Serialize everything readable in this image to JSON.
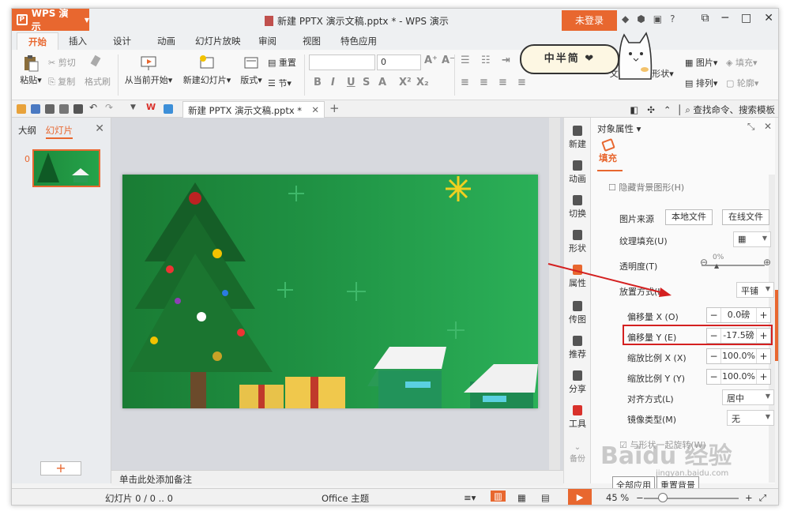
{
  "titlebar": {
    "app_name": "WPS 演示",
    "doc_title": "新建 PPTX 演示文稿.pptx * - WPS 演示",
    "login": "未登录"
  },
  "menu": [
    "开始",
    "插入",
    "设计",
    "动画",
    "幻灯片放映",
    "审阅",
    "视图",
    "特色应用"
  ],
  "ribbon": {
    "paste": "粘贴",
    "cut": "剪切",
    "copy": "复制",
    "format_painter": "格式刷",
    "from_current": "从当前开始",
    "new_slide": "新建幻灯片",
    "layout": "版式",
    "reset": "重置",
    "section": "节",
    "font_size": "0",
    "textbox": "文本框",
    "shape": "形状",
    "picture": "图片",
    "fill": "填充",
    "arrange": "排列",
    "outline": "轮廓"
  },
  "quickbar": {
    "doc_tab": "新建 PPTX 演示文稿.pptx *",
    "search": "查找命令、搜索模板"
  },
  "left_pane": {
    "tab_outline": "大纲",
    "tab_slides": "幻灯片",
    "slide_number": "0"
  },
  "notes_placeholder": "单击此处添加备注",
  "side_strip": [
    "新建",
    "动画",
    "切换",
    "形状",
    "属性",
    "传图",
    "推荐",
    "分享",
    "工具",
    "备份"
  ],
  "props": {
    "header": "对象属性",
    "fill_tab": "填充",
    "hidden_bg": "隐藏背景图形(H)",
    "picture_source": "图片来源",
    "local_file": "本地文件",
    "online_file": "在线文件",
    "texture_fill": "纹理填充(U)",
    "transparency": "透明度(T)",
    "transparency_value": "0%",
    "placement": "放置方式(I)",
    "placement_value": "平铺",
    "offset_x_label": "偏移量 X (O)",
    "offset_x": "0.0磅",
    "offset_y_label": "偏移量 Y (E)",
    "offset_y": "-17.5磅",
    "scale_x_label": "缩放比例 X (X)",
    "scale_x": "100.0%",
    "scale_y_label": "缩放比例 Y (Y)",
    "scale_y": "100.0%",
    "align_label": "对齐方式(L)",
    "align_value": "居中",
    "mirror_label": "镜像类型(M)",
    "mirror_value": "无",
    "rotate_with_shape": "与形状一起旋转(W)",
    "apply_all": "全部应用",
    "reset_bg": "重置背景"
  },
  "statusbar": {
    "slide_info": "幻灯片 0 / 0 .. 0",
    "theme": "Office 主题",
    "zoom": "45 %"
  },
  "overlay": {
    "sticker": "中半简 ❤",
    "watermark": "Baidu 经验",
    "watermark_url": "jingyan.baidu.com"
  }
}
